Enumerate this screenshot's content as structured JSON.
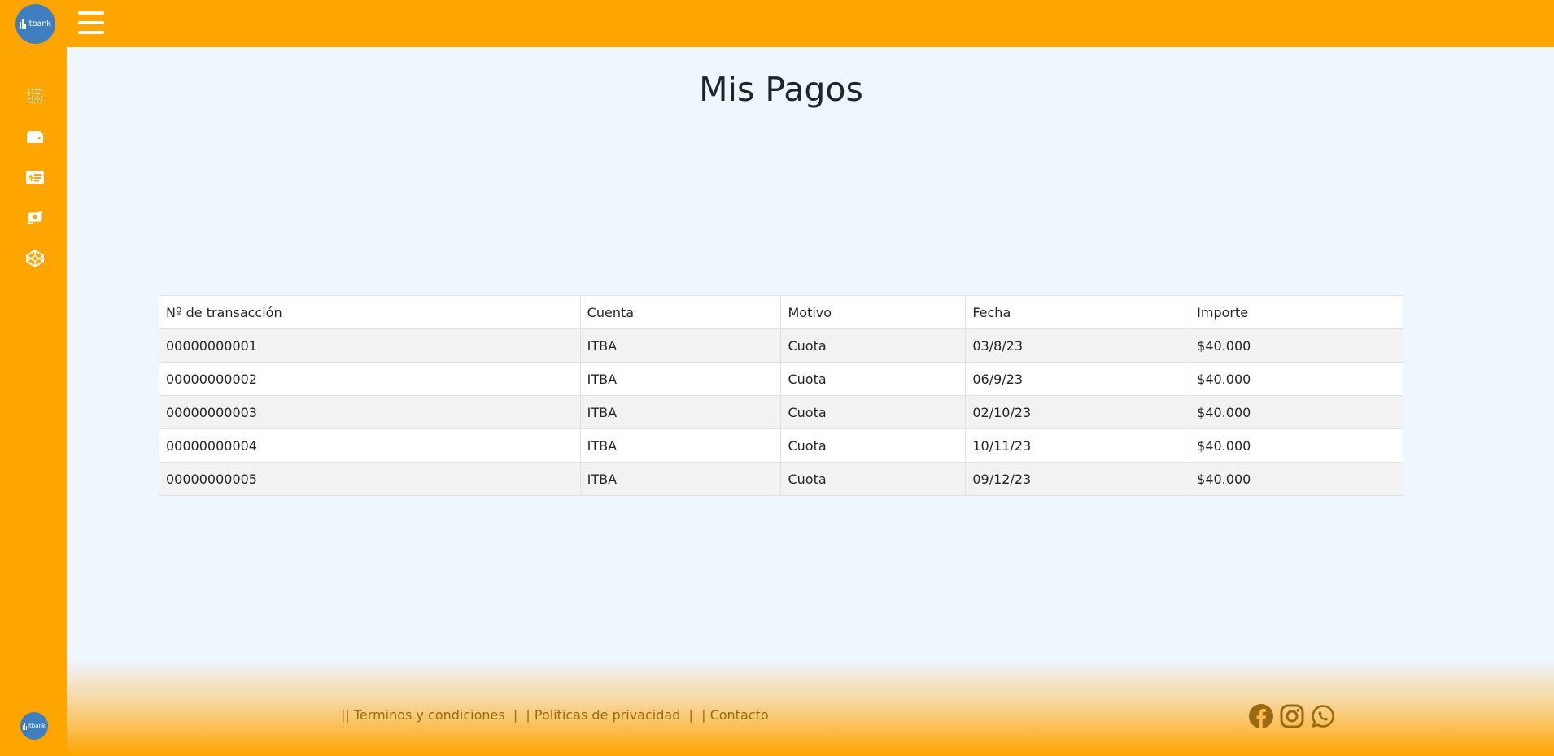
{
  "brand": {
    "logo_text": "itbank",
    "primary_color": "#ffa500",
    "logo_color": "#3f7fbf",
    "background_color": "#eef6fe"
  },
  "topbar": {
    "menu_icon": "hamburger-menu-icon"
  },
  "sidebar": {
    "items": [
      {
        "icon": "dashboard-grid-icon"
      },
      {
        "icon": "wallet-icon"
      },
      {
        "icon": "payments-list-icon"
      },
      {
        "icon": "money-transfer-icon"
      },
      {
        "icon": "codepen-icon"
      }
    ]
  },
  "main": {
    "title": "Mis Pagos"
  },
  "table": {
    "headers": [
      "Nº de transacción",
      "Cuenta",
      "Motivo",
      "Fecha",
      "Importe"
    ],
    "rows": [
      [
        "00000000001",
        "ITBA",
        "Cuota",
        "03/8/23",
        "$40.000"
      ],
      [
        "00000000002",
        "ITBA",
        "Cuota",
        "06/9/23",
        "$40.000"
      ],
      [
        "00000000003",
        "ITBA",
        "Cuota",
        "02/10/23",
        "$40.000"
      ],
      [
        "00000000004",
        "ITBA",
        "Cuota",
        "10/11/23",
        "$40.000"
      ],
      [
        "00000000005",
        "ITBA",
        "Cuota",
        "09/12/23",
        "$40.000"
      ]
    ]
  },
  "footer": {
    "prefix": "||",
    "links": [
      "Terminos y condiciones",
      "Politicas de privacidad",
      "Contacto"
    ],
    "social": [
      "facebook-icon",
      "instagram-icon",
      "whatsapp-icon"
    ],
    "text_color": "#9a6a12"
  }
}
